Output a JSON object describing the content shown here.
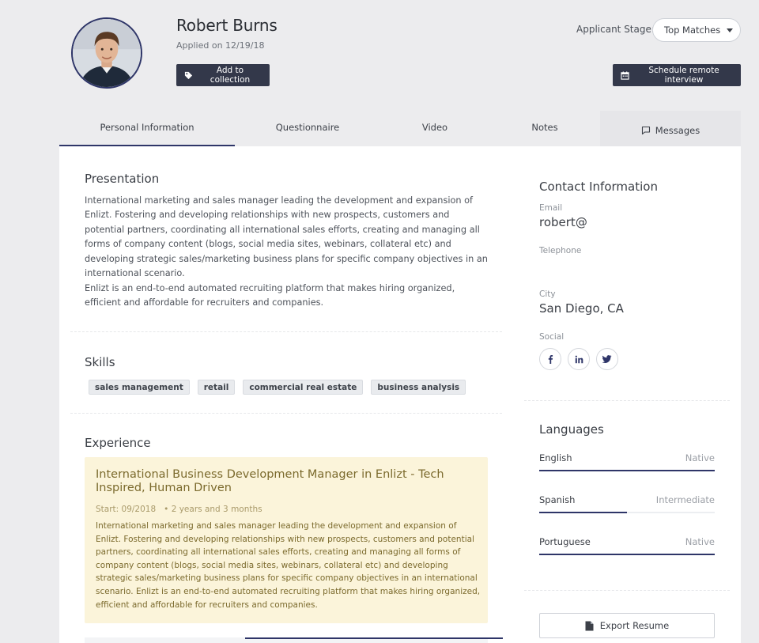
{
  "header": {
    "name": "Robert Burns",
    "applied": "Applied on 12/19/18",
    "add_collection_label": "Add to collection",
    "schedule_label": "Schedule remote interview",
    "stage_label": "Applicant Stage:",
    "stage_value": "Top Matches"
  },
  "tabs": [
    {
      "label": "Personal Information",
      "active": true
    },
    {
      "label": "Questionnaire"
    },
    {
      "label": "Video"
    },
    {
      "label": "Notes"
    },
    {
      "label": "Messages"
    }
  ],
  "presentation": {
    "title": "Presentation",
    "paragraph1": "International marketing and sales manager leading the development and expansion of Enlizt. Fostering and developing relationships with new prospects, customers and potential partners, coordinating all international sales efforts, creating and managing all forms of company content (blogs, social media sites, webinars, collateral etc) and developing strategic sales/marketing business plans for specific company objectives in an international scenario.",
    "paragraph2": "Enlizt is an end-to-end automated recruiting platform that makes hiring organized, efficient and affordable for recruiters and companies."
  },
  "skills": {
    "title": "Skills",
    "items": [
      "sales management",
      "retail",
      "commercial real estate",
      "business analysis"
    ]
  },
  "experience": {
    "title": "Experience",
    "items": [
      {
        "title": "International Business Development Manager in Enlizt - Tech Inspired, Human Driven",
        "start": "Start: 09/2018",
        "duration": "• 2 years and 3 months",
        "description": "International marketing and sales manager leading the development and expansion of Enlizt. Fostering and developing relationships with new prospects, customers and potential partners, coordinating all international sales efforts, creating and managing all forms of company content (blogs, social media sites, webinars, collateral etc) and developing strategic sales/marketing business plans for specific company objectives in an international scenario. Enlizt is an end-to-end automated recruiting platform that makes hiring organized, efficient and affordable for recruiters and companies."
      }
    ]
  },
  "contact": {
    "title": "Contact Information",
    "email_label": "Email",
    "email_value": "robert@",
    "telephone_label": "Telephone",
    "telephone_value": "",
    "city_label": "City",
    "city_value": "San Diego, CA",
    "social_label": "Social",
    "social_icons": [
      "facebook-icon",
      "linkedin-icon",
      "twitter-icon"
    ]
  },
  "languages": {
    "title": "Languages",
    "items": [
      {
        "name": "English",
        "level": "Native",
        "proficiency": 1.0
      },
      {
        "name": "Spanish",
        "level": "Intermediate",
        "proficiency": 0.5
      },
      {
        "name": "Portuguese",
        "level": "Native",
        "proficiency": 1.0
      }
    ]
  },
  "export_label": "Export Resume",
  "colors": {
    "accent": "#2e3568",
    "dark_button": "#33384a",
    "experience_bg": "#fbf4da",
    "experience_text": "#7b6a2d"
  }
}
